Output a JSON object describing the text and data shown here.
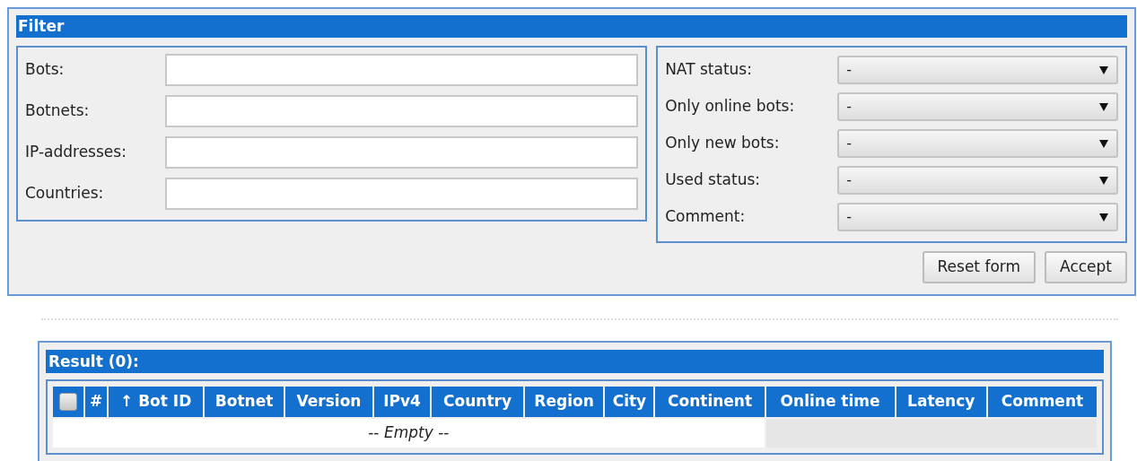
{
  "filter": {
    "title": "Filter",
    "text_fields": [
      {
        "label": "Bots:"
      },
      {
        "label": "Botnets:"
      },
      {
        "label": "IP-addresses:"
      },
      {
        "label": "Countries:"
      }
    ],
    "selects": [
      {
        "label": "NAT status:",
        "value": "-"
      },
      {
        "label": "Only online bots:",
        "value": "-"
      },
      {
        "label": "Only new bots:",
        "value": "-"
      },
      {
        "label": "Used status:",
        "value": "-"
      },
      {
        "label": "Comment:",
        "value": "-"
      }
    ],
    "buttons": [
      "Reset form",
      "Accept"
    ]
  },
  "result": {
    "title": "Result (0):",
    "select_all": {
      "checked": false
    },
    "columns": [
      "#",
      "↑ Bot ID",
      "Botnet",
      "Version",
      "IPv4",
      "Country",
      "Region",
      "City",
      "Continent",
      "Online time",
      "Latency",
      "Comment"
    ],
    "empty_text": "-- *Empty* --"
  }
}
